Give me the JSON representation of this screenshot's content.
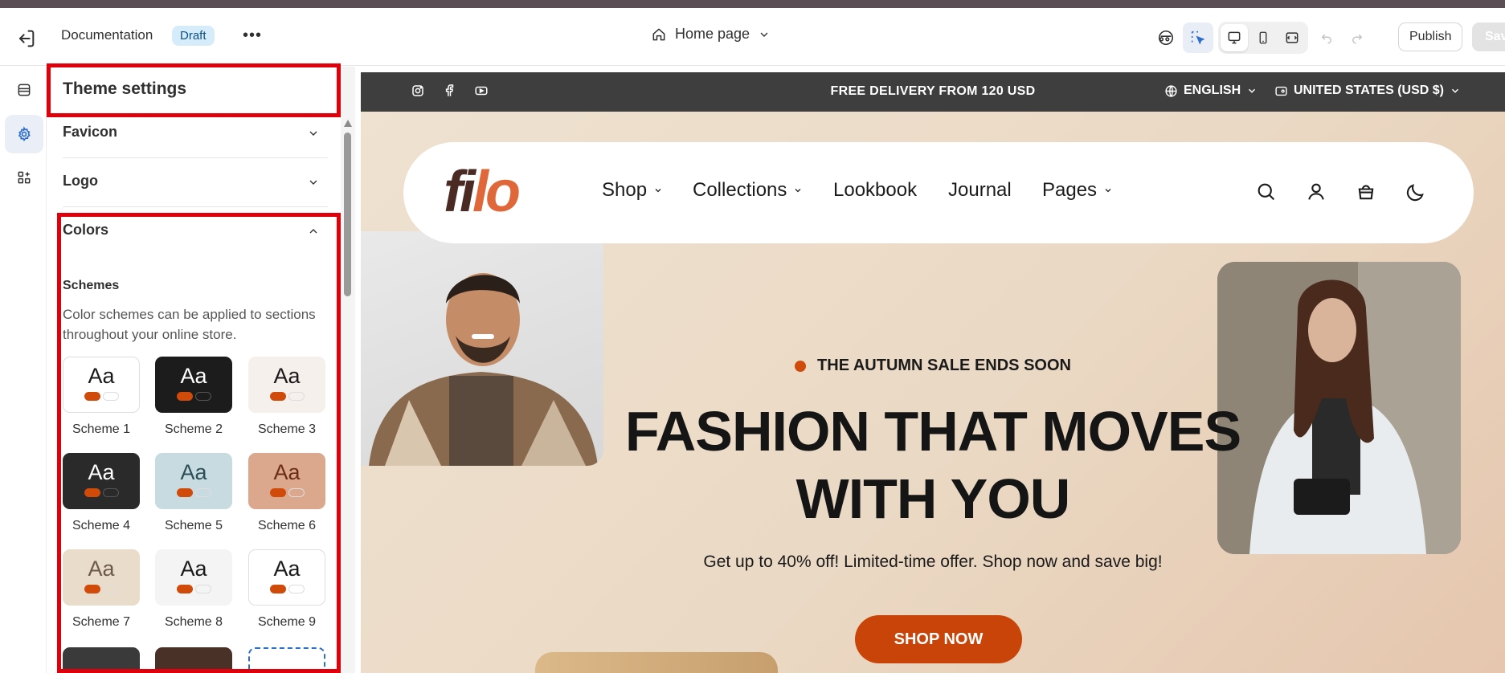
{
  "topbar": {
    "doc_name": "Documentation",
    "status_badge": "Draft",
    "more": "•••",
    "page_selector": "Home page",
    "publish_label": "Publish",
    "save_label": "Save"
  },
  "panel": {
    "title": "Theme settings",
    "sections": [
      {
        "label": "Favicon",
        "expanded": false
      },
      {
        "label": "Logo",
        "expanded": false
      },
      {
        "label": "Colors",
        "expanded": true
      }
    ],
    "schemes_heading": "Schemes",
    "schemes_description": "Color schemes can be applied to sections throughout your online store.",
    "schemes": [
      {
        "label": "Scheme 1",
        "sample": "Aa",
        "bg": "#ffffff",
        "text": "#1a1a1a"
      },
      {
        "label": "Scheme 2",
        "sample": "Aa",
        "bg": "#1c1c1c",
        "text": "#ffffff"
      },
      {
        "label": "Scheme 3",
        "sample": "Aa",
        "bg": "#f5f0ec",
        "text": "#1a1a1a"
      },
      {
        "label": "Scheme 4",
        "sample": "Aa",
        "bg": "#2a2a2a",
        "text": "#ffffff"
      },
      {
        "label": "Scheme 5",
        "sample": "Aa",
        "bg": "#c8dbe0",
        "text": "#2c4f57"
      },
      {
        "label": "Scheme 6",
        "sample": "Aa",
        "bg": "#dba88d",
        "text": "#6b2e14"
      },
      {
        "label": "Scheme 7",
        "sample": "Aa",
        "bg": "#e9dccb",
        "text": "#6b5a4a"
      },
      {
        "label": "Scheme 8",
        "sample": "Aa",
        "bg": "#f4f4f4",
        "text": "#1a1a1a"
      },
      {
        "label": "Scheme 9",
        "sample": "Aa",
        "bg": "#ffffff",
        "text": "#1a1a1a"
      }
    ]
  },
  "store": {
    "announcement": "FREE DELIVERY FROM 120 USD",
    "language": "ENGLISH",
    "currency": "UNITED STATES (USD $)",
    "logo": {
      "part1": "fi",
      "part2": "lo"
    },
    "menu": [
      "Shop",
      "Collections",
      "Lookbook",
      "Journal",
      "Pages"
    ],
    "eyebrow": "THE AUTUMN SALE ENDS SOON",
    "headline_line1": "FASHION THAT MOVES",
    "headline_line2": "WITH YOU",
    "subtext": "Get up to 40% off! Limited-time offer. Shop now and save big!",
    "cta": "SHOP NOW"
  },
  "colors": {
    "accent": "#d04a0a",
    "highlight_box": "#e0000b"
  }
}
